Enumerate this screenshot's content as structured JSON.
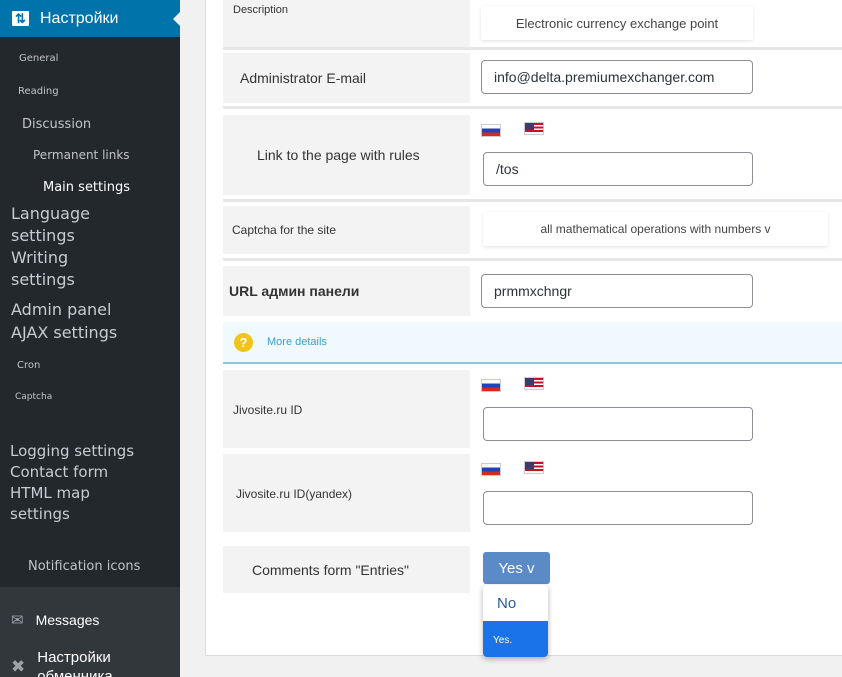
{
  "sidebar": {
    "header": {
      "label": "Настройки",
      "icon": "sliders-icon"
    },
    "items": [
      {
        "label": "General"
      },
      {
        "label": "Reading"
      },
      {
        "label": "Discussion"
      },
      {
        "label": "Permanent links"
      },
      {
        "label": "Main settings"
      },
      {
        "label": "Language settings"
      },
      {
        "label": "Writing settings"
      },
      {
        "label": "Admin panel AJAX settings"
      },
      {
        "label": "Cron"
      },
      {
        "label": "Captcha"
      },
      {
        "label": "Logging settings Contact form HTML map settings"
      },
      {
        "label": "Notification icons"
      }
    ],
    "bottom": [
      {
        "label": "Messages",
        "icon": "envelope-icon"
      },
      {
        "label": "Настройки обменника",
        "icon": "tools-icon"
      }
    ]
  },
  "form": {
    "description": {
      "label": "Description",
      "value": "Electronic currency exchange point"
    },
    "admin_email": {
      "label": "Administrator E-mail",
      "value": "info@delta.premiumexchanger.com"
    },
    "rules_link": {
      "label": "Link to the page with rules",
      "value": "/tos"
    },
    "captcha": {
      "label": "Captcha for the site",
      "value": "all mathematical operations with numbers v"
    },
    "admin_url": {
      "label": "URL админ панели",
      "value": "prmmxchngr"
    },
    "info": {
      "link": "More details"
    },
    "jivosite": {
      "label": "Jivosite.ru ID",
      "value": ""
    },
    "jivosite_yandex": {
      "label": "Jivosite.ru ID(yandex)",
      "value": ""
    },
    "comments": {
      "label": "Comments form \"Entries\"",
      "selected": "Yes v",
      "options": [
        "No",
        "Yes."
      ]
    }
  },
  "colors": {
    "accent": "#0073aa",
    "sidebar_bg": "#23282d",
    "select_bg": "#5b8bc7",
    "option_highlight": "#1a73e8"
  }
}
